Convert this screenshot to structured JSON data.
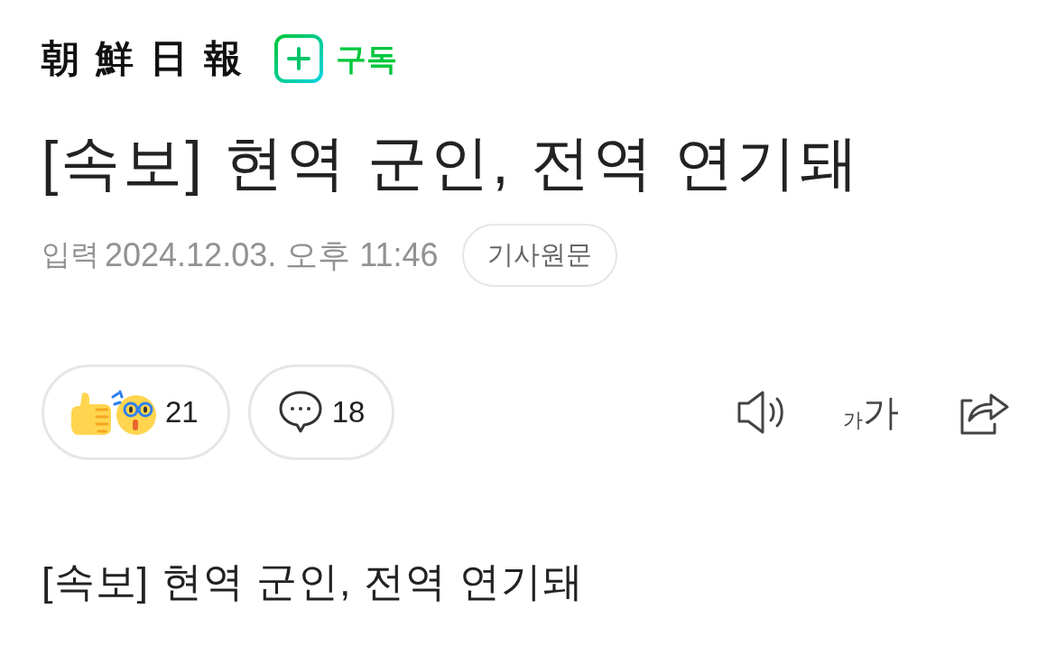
{
  "header": {
    "logo": "朝鮮日報",
    "subscribe_label": "구독"
  },
  "article": {
    "title": "[속보] 현역 군인, 전역 연기돼",
    "published_label": "입력",
    "published_at": "2024.12.03. 오후 11:46",
    "original_link": "기사원문"
  },
  "reactions": {
    "count": "21"
  },
  "comments": {
    "count": "18"
  },
  "tools": {
    "font_size_small": "가",
    "font_size_large": "가"
  },
  "body": {
    "text": "[속보] 현역 군인, 전역 연기돼"
  }
}
